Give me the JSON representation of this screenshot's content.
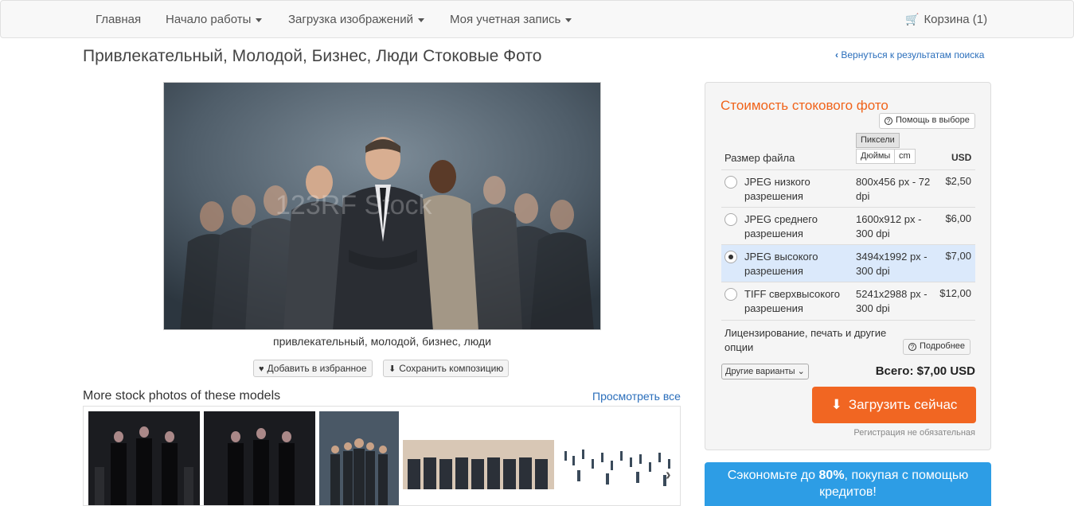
{
  "nav": {
    "home": "Главная",
    "getting_started": "Начало работы",
    "upload": "Загрузка изображений",
    "account": "Моя учетная запись",
    "cart": "Корзина (1)"
  },
  "page": {
    "title": "Привлекательный, Молодой, Бизнес, Люди Стоковые Фото",
    "back_link": "Вернуться к результатам поиска"
  },
  "photo": {
    "caption": "привлекательный, молодой, бизнес, люди",
    "watermark": "123RF Stock",
    "add_favorite": "Добавить в избранное",
    "save_composition": "Сохранить композицию"
  },
  "more": {
    "title": "More stock photos of these models",
    "view_all": "Просмотреть все"
  },
  "pricing": {
    "title": "Стоимость стокового фото",
    "help": "Помощь в выборе",
    "units": {
      "pixels": "Пиксели",
      "inches": "Дюймы",
      "cm": "cm"
    },
    "col_size": "Размер файла",
    "col_currency": "USD",
    "options": [
      {
        "name": "JPEG низкого разрешения",
        "dims": "800x456 px - 72 dpi",
        "price": "$2,50",
        "selected": false
      },
      {
        "name": "JPEG среднего разрешения",
        "dims": "1600x912 px - 300 dpi",
        "price": "$6,00",
        "selected": false
      },
      {
        "name": "JPEG высокого разрешения",
        "dims": "3494x1992 px - 300 dpi",
        "price": "$7,00",
        "selected": true
      },
      {
        "name": "TIFF сверхвысокого разрешения",
        "dims": "5241x2988 px - 300 dpi",
        "price": "$12,00",
        "selected": false
      }
    ],
    "license_text": "Лицензирование, печать и другие опции",
    "more_info": "Подробнее",
    "other_options": "Другие варианты",
    "total": "Всего: $7,00 USD",
    "download": "Загрузить сейчас",
    "registration_note": "Регистрация не обязательная"
  },
  "promo": {
    "prefix": "Сэкономьте до ",
    "highlight": "80%",
    "suffix": ", покупая с помощью кредитов!"
  },
  "colors": {
    "accent_orange": "#f16622",
    "link_blue": "#2a6ebb",
    "promo_blue": "#2d9de5",
    "selected_row": "#dbe9fb"
  }
}
